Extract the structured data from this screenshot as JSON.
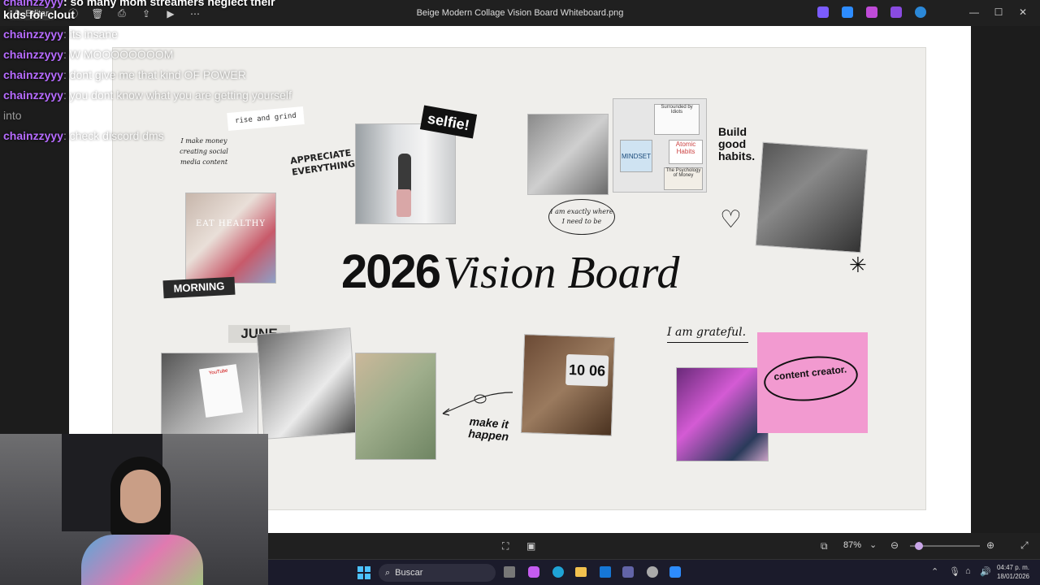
{
  "window": {
    "title": "Beige Modern Collage Vision Board Whiteboard.png",
    "edit_label": "Editar",
    "toolbar_icons": [
      "info-icon",
      "delete-icon",
      "print-icon",
      "share-icon",
      "slideshow-icon",
      "more-icon"
    ],
    "app_icons": [
      {
        "name": "copilot-app-icon",
        "color": "#7b5cff"
      },
      {
        "name": "designer-app-icon",
        "color": "#2d8cff"
      },
      {
        "name": "clipchamp-app-icon",
        "color": "#c04bd8"
      },
      {
        "name": "clipchamp-video-icon",
        "color": "#8a4be0"
      },
      {
        "name": "onedrive-icon",
        "color": "#2b88d8"
      }
    ]
  },
  "chat": {
    "messages": [
      {
        "user": "chainzzyyy",
        "text": ": so many mom streamers neglect their kids for clout",
        "highlight": true
      },
      {
        "user": "chainzzyyy",
        "text": ": its insane",
        "highlight": false
      },
      {
        "user": "chainzzyyy",
        "text": ": W MOOOOOOOOM",
        "highlight": false
      },
      {
        "user": "chainzzyyy",
        "text": ": dont give me that kind OF POWER",
        "highlight": false
      },
      {
        "user": "chainzzyyy",
        "text": ": you dont know what you are getting yourself into",
        "highlight": false
      },
      {
        "user": "chainzzyyy",
        "text": ": check discord dms",
        "highlight": false
      }
    ]
  },
  "board": {
    "title_year": "2026",
    "title_text": "Vision Board",
    "rise_grind": "rise and grind",
    "money_note": "I make money creating social media content",
    "appreciate": "APPRECIATE EVERYTHING",
    "selfie": "selfie!",
    "eat_healthy": "EAT HEALTHY",
    "morning": "MORNING",
    "exactly_note": "I am exactly where I need to be",
    "build_habits": "Build good habits.",
    "book_titles": [
      "Atomic Habits",
      "MINDSET",
      "Surrounded by Idiots",
      "The Psychology of Money"
    ],
    "june": "JUNE",
    "clock": "10 06",
    "make_it_happen": "make it happen",
    "grateful": "I am grateful.",
    "content_creator": "content creator.",
    "youtube_label": "YouTube"
  },
  "statusbar": {
    "zoom": "87%"
  },
  "taskbar": {
    "search_placeholder": "Buscar",
    "time": "04:47 p. m.",
    "date": "18/01/2026"
  }
}
